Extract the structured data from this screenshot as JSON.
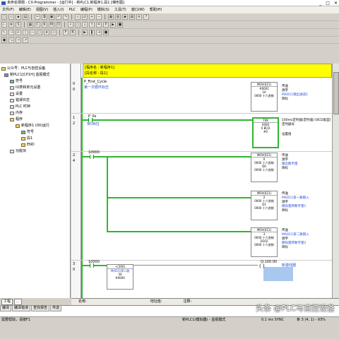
{
  "window": {
    "title": "未命名標題 - CX-Programmer - [运行中] - 新PLC1.新程序1.段1 [梯形图]"
  },
  "menu": [
    "文件(F)",
    "编辑(E)",
    "视图(V)",
    "插入(I)",
    "PLC",
    "编程(P)",
    "模拟(S)",
    "工具(T)",
    "窗口(W)",
    "帮助(H)"
  ],
  "tree": [
    {
      "label": "公众号：PLC与自控设备",
      "level": 0,
      "icon": "folder-icon"
    },
    {
      "label": "新PLC1[CP1H] 监视模式",
      "level": 1,
      "icon": "plc-icon"
    },
    {
      "label": "符号",
      "level": 2,
      "icon": "symbols-icon"
    },
    {
      "label": "IO表和单元设置",
      "level": 2,
      "icon": "io-table-icon"
    },
    {
      "label": "设置",
      "level": 2,
      "icon": "settings-icon"
    },
    {
      "label": "错误日志",
      "level": 2,
      "icon": "error-log-icon"
    },
    {
      "label": "PLC 时钟",
      "level": 2,
      "icon": "clock-icon"
    },
    {
      "label": "内存",
      "level": 2,
      "icon": "memory-icon"
    },
    {
      "label": "程序",
      "level": 2,
      "icon": "programs-icon"
    },
    {
      "label": "新程序1 (00)运行",
      "level": 3,
      "icon": "program-icon"
    },
    {
      "label": "符号",
      "level": 4,
      "icon": "symbols-icon"
    },
    {
      "label": "段1",
      "level": 4,
      "icon": "section-icon"
    },
    {
      "label": "END",
      "level": 4,
      "icon": "end-icon"
    },
    {
      "label": "功能块",
      "level": 2,
      "icon": "function-block-icon"
    }
  ],
  "banner": {
    "line1": "[程序名 : 新程序1]",
    "line2": "[段名称 : 段1]"
  },
  "rungs": [
    {
      "num": "0",
      "step": "0"
    },
    {
      "num": "1",
      "step": "2"
    },
    {
      "num": "2",
      "step": "4"
    },
    {
      "num": "3",
      "step": "0"
    }
  ],
  "ladder": {
    "r0": {
      "contact": "P_First_Cycle",
      "contact_comment": "第一次循环标志",
      "inst": "MOV(021)",
      "op1": "#0001",
      "op2": "10",
      "op3": "0000 十六进制",
      "c1": "传送",
      "c2": "源字",
      "c3": "MAD11输出通道1",
      "c4": "目标"
    },
    "r1": {
      "contact": "P_0s",
      "contact_comment": "常ON位",
      "inst": "TIM",
      "op1": "0000",
      "op2": "0 BCD",
      "op3": "#0",
      "c1": "100ms定时器(定时器) [BCD类型]",
      "c2": "定时器号",
      "c3": "设置值"
    },
    "r2": {
      "contact": "10000",
      "blocks": [
        {
          "inst": "MOV(021)",
          "op1": "0",
          "op2": "0000 十六进制",
          "op3": "D0",
          "op4": "0000 十六进制",
          "c1": "传送",
          "c2": "源字",
          "c3": "输出数字量",
          "c4": "目标"
        },
        {
          "inst": "MOV(021)",
          "op1": "2",
          "op2": "0000 十六进制",
          "op3": "D1",
          "op4": "0000 十六进制",
          "c1": "传送",
          "c2": "MAD11第一路输入",
          "c3": "源字",
          "c4": "模拟量转数字量1",
          "c5": "目标"
        },
        {
          "inst": "MOV(021)",
          "op1": "3",
          "op2": "0000 十六进制",
          "op3": "D102",
          "op4": "0000 十六进制",
          "c1": "传送",
          "c2": "MAD11第二路输入",
          "c3": "源字",
          "c4": "模拟量转数字量2",
          "c5": "目标"
        }
      ]
    },
    "r3": {
      "contact": "10000",
      "cmp": "<(300)",
      "cmp_op1": "MAD11第二路",
      "cmp_op2": "#0000",
      "coil": "Q:100.00",
      "coil_comment": "新建线圈",
      "cmp_val": "50"
    }
  },
  "watch": {
    "name": "名称:",
    "address": "地址值:",
    "comment": "注释:"
  },
  "bottom_tabs": [
    "工程",
    "..."
  ],
  "output_tabs": [
    "编译",
    "编译错误",
    "查找报告",
    "传送"
  ],
  "status": {
    "help": "需要帮助，请按F1",
    "plc": "新PLC1(模拟器) - 监视模式",
    "cycle": "0.1 ms SYNC",
    "pos": "条 3 (4, 1) - 93%"
  },
  "watermark": "头条 @PLC与自控设备"
}
